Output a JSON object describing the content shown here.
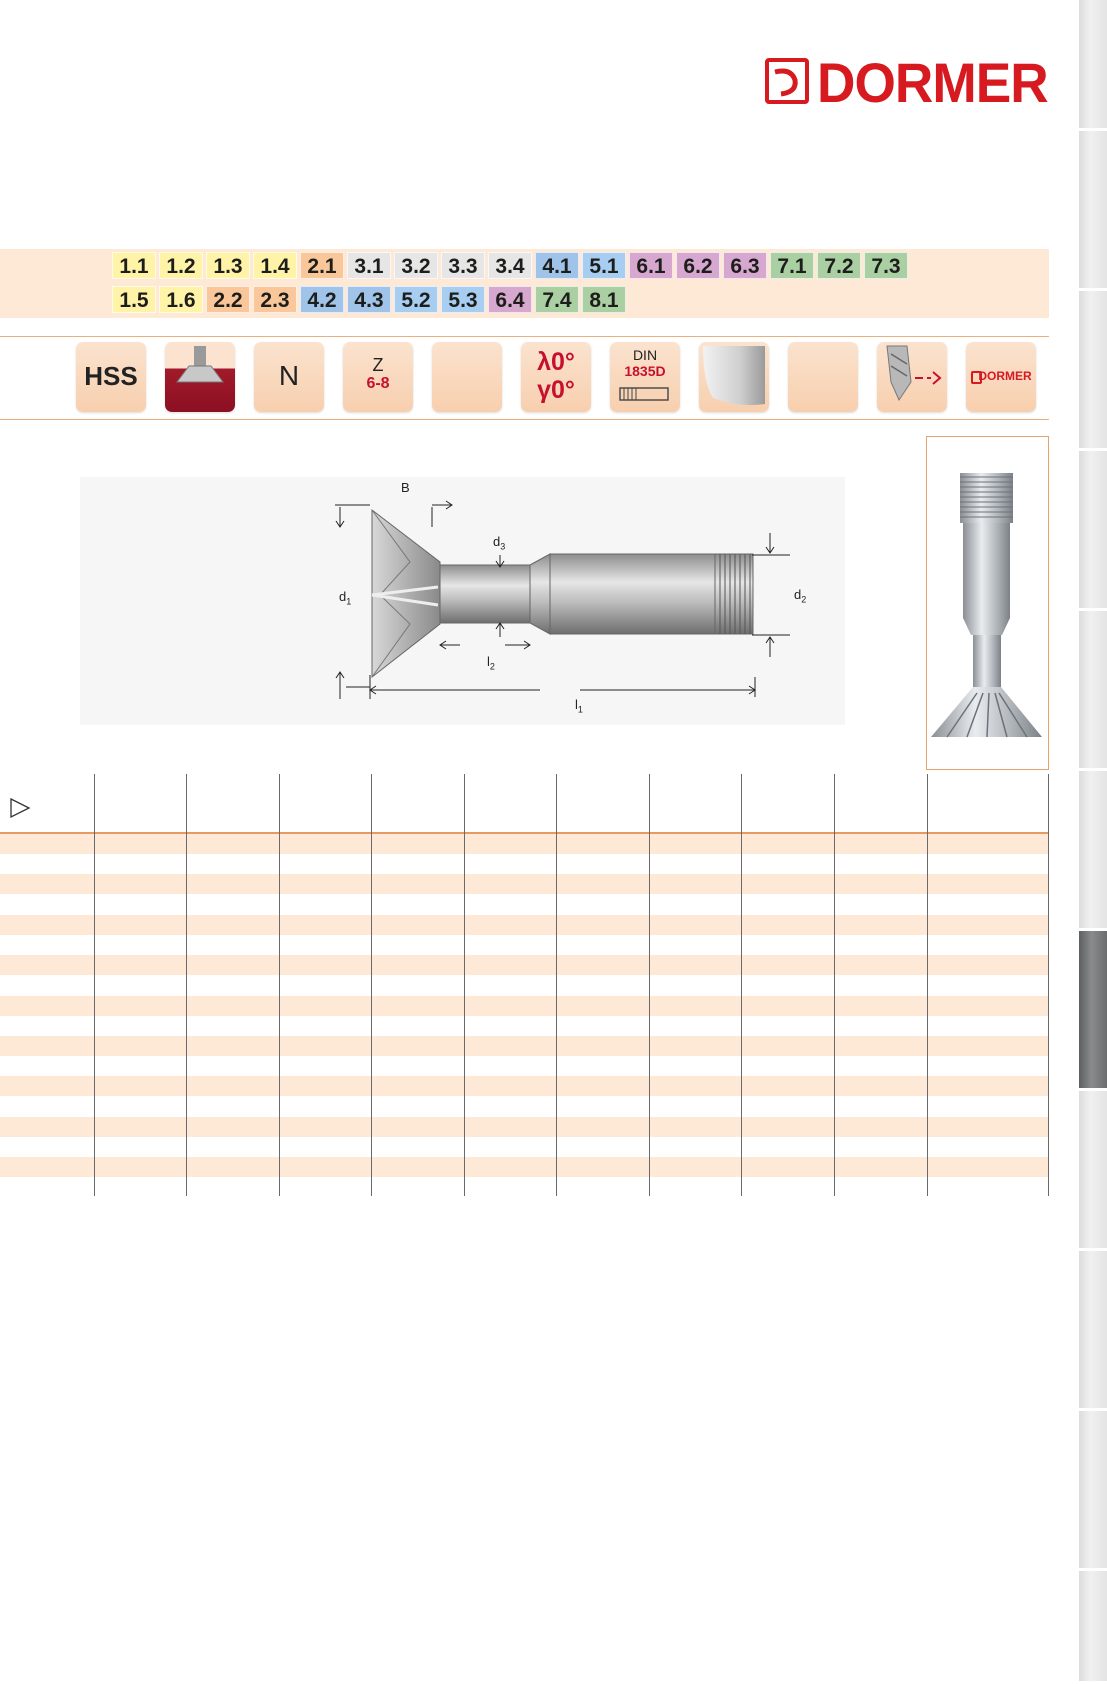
{
  "brand": {
    "name": "DORMER",
    "color": "#d71920"
  },
  "materials": {
    "row1": [
      {
        "label": "1.1",
        "color": "#fff3a8"
      },
      {
        "label": "1.2",
        "color": "#fff3a8"
      },
      {
        "label": "1.3",
        "color": "#fff3a8"
      },
      {
        "label": "1.4",
        "color": "#fff3a8"
      },
      {
        "label": "2.1",
        "color": "#f9c79a"
      },
      {
        "label": "3.1",
        "color": "#e6e6e6"
      },
      {
        "label": "3.2",
        "color": "#e6e6e6"
      },
      {
        "label": "3.3",
        "color": "#e6e6e6"
      },
      {
        "label": "3.4",
        "color": "#e6e6e6"
      },
      {
        "label": "4.1",
        "color": "#9fc3e9"
      },
      {
        "label": "5.1",
        "color": "#a7cdf0"
      },
      {
        "label": "6.1",
        "color": "#d6a7cf"
      },
      {
        "label": "6.2",
        "color": "#d6a7cf"
      },
      {
        "label": "6.3",
        "color": "#d6a7cf"
      },
      {
        "label": "7.1",
        "color": "#a9cfa3"
      },
      {
        "label": "7.2",
        "color": "#a9cfa3"
      },
      {
        "label": "7.3",
        "color": "#a9cfa3"
      }
    ],
    "row2": [
      {
        "label": "1.5",
        "color": "#fff3a8"
      },
      {
        "label": "1.6",
        "color": "#fff3a8"
      },
      {
        "label": "2.2",
        "color": "#f9c79a"
      },
      {
        "label": "2.3",
        "color": "#f9c79a"
      },
      {
        "label": "4.2",
        "color": "#9fc3e9"
      },
      {
        "label": "4.3",
        "color": "#9fc3e9"
      },
      {
        "label": "5.2",
        "color": "#a7cdf0"
      },
      {
        "label": "5.3",
        "color": "#a7cdf0"
      },
      {
        "label": "6.4",
        "color": "#d6a7cf"
      },
      {
        "label": "7.4",
        "color": "#a9cfa3"
      },
      {
        "label": "8.1",
        "color": "#a9cfa3"
      }
    ]
  },
  "icons": {
    "hss": "HSS",
    "type_n": "N",
    "teeth_z": "Z",
    "teeth_range": "6-8",
    "helix_lambda": "λ0°",
    "rake_gamma": "γ0°",
    "din": "DIN",
    "din_number": "1835D",
    "dormer_small": "DORMER"
  },
  "drawing": {
    "label_B": "B",
    "label_d1": "d",
    "sub_d1": "1",
    "label_d2": "d",
    "sub_d2": "2",
    "label_d3": "d",
    "sub_d3": "3",
    "label_l1": "l",
    "sub_l1": "1",
    "label_l2": "l",
    "sub_l2": "2"
  },
  "table": {
    "columns": 11,
    "rows": 17,
    "stripe_color": "#fde9d6",
    "header_rule_color": "#e69a63"
  }
}
